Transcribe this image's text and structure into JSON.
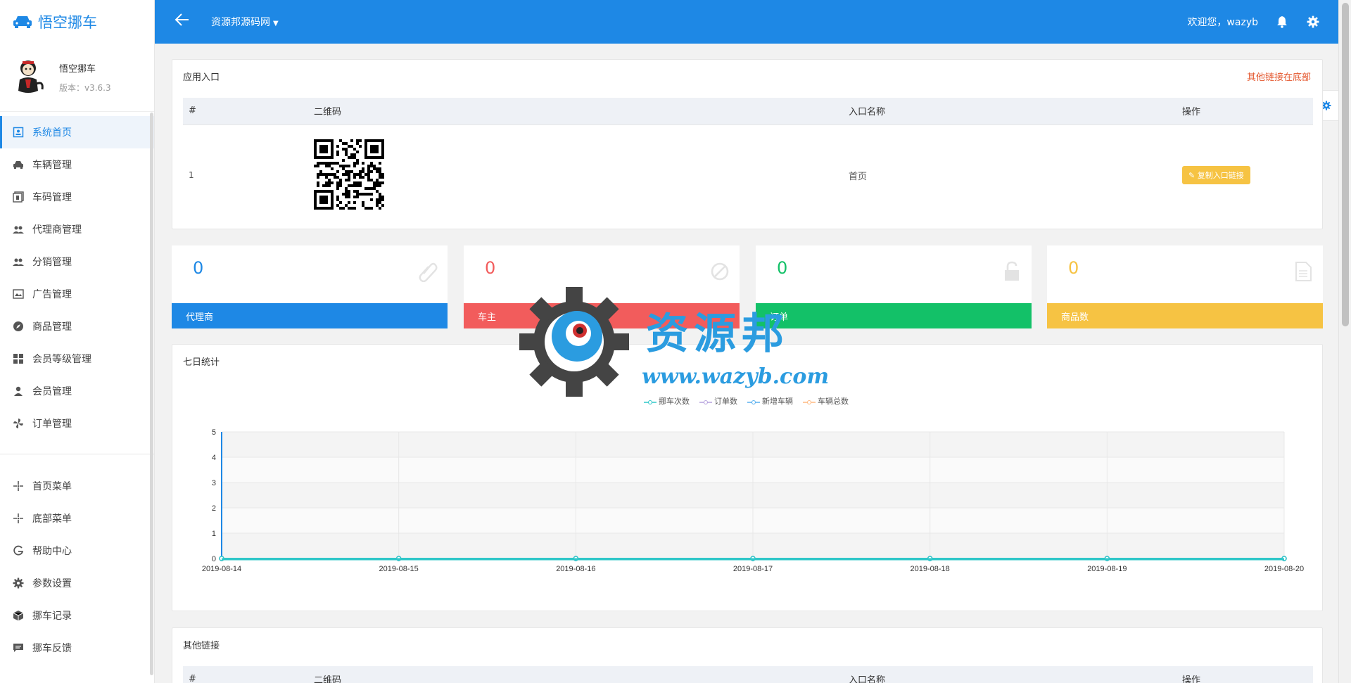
{
  "app": {
    "name": "悟空挪车",
    "version_label": "版本：v3.6.3"
  },
  "header": {
    "site": "资源邦源码网",
    "welcome": "欢迎您，wazyb"
  },
  "sidebar": {
    "items": [
      {
        "label": "系统首页",
        "icon": "home-icon"
      },
      {
        "label": "车辆管理",
        "icon": "car-icon"
      },
      {
        "label": "车码管理",
        "icon": "qrcode-icon"
      },
      {
        "label": "代理商管理",
        "icon": "agents-icon"
      },
      {
        "label": "分销管理",
        "icon": "distribution-icon"
      },
      {
        "label": "广告管理",
        "icon": "ad-icon"
      },
      {
        "label": "商品管理",
        "icon": "compass-icon"
      },
      {
        "label": "会员等级管理",
        "icon": "grid-icon"
      },
      {
        "label": "会员管理",
        "icon": "user-icon"
      },
      {
        "label": "订单管理",
        "icon": "pinwheel-icon"
      }
    ],
    "items2": [
      {
        "label": "首页菜单",
        "icon": "sparkle-icon"
      },
      {
        "label": "底部菜单",
        "icon": "sparkle-icon"
      },
      {
        "label": "帮助中心",
        "icon": "g-icon"
      },
      {
        "label": "参数设置",
        "icon": "gear-icon"
      },
      {
        "label": "挪车记录",
        "icon": "box-icon"
      },
      {
        "label": "挪车反馈",
        "icon": "chat-icon"
      }
    ]
  },
  "entry": {
    "title": "应用入口",
    "link": "其他链接在底部",
    "cols": [
      "#",
      "二维码",
      "入口名称",
      "操作"
    ],
    "row": {
      "index": "1",
      "name": "首页",
      "action": "复制入口链接"
    }
  },
  "stats": [
    {
      "value": "0",
      "label": "代理商",
      "color": "#1e88e5",
      "icon": "paperclip-icon"
    },
    {
      "value": "0",
      "label": "车主",
      "color": "#f25c5c",
      "icon": "ban-icon"
    },
    {
      "value": "0",
      "label": "订单",
      "color": "#13c168",
      "icon": "unlock-icon"
    },
    {
      "value": "0",
      "label": "商品数",
      "color": "#f6c343",
      "icon": "file-icon"
    }
  ],
  "weekly": {
    "title": "七日统计"
  },
  "other": {
    "title": "其他链接",
    "cols": [
      "#",
      "二维码",
      "入口名称",
      "操作"
    ]
  },
  "watermark": {
    "cn": "资源邦",
    "url": "www.wazyb.com"
  },
  "chart_data": {
    "type": "line",
    "categories": [
      "2019-08-14",
      "2019-08-15",
      "2019-08-16",
      "2019-08-17",
      "2019-08-18",
      "2019-08-19",
      "2019-08-20"
    ],
    "series": [
      {
        "name": "挪车次数",
        "values": [
          0,
          0,
          0,
          0,
          0,
          0,
          0
        ],
        "color": "#2ec7c9"
      },
      {
        "name": "订单数",
        "values": [
          0,
          0,
          0,
          0,
          0,
          0,
          0
        ],
        "color": "#b6a2de"
      },
      {
        "name": "新增车辆",
        "values": [
          0,
          0,
          0,
          0,
          0,
          0,
          0
        ],
        "color": "#5ab1ef"
      },
      {
        "name": "车辆总数",
        "values": [
          0,
          0,
          0,
          0,
          0,
          0,
          0
        ],
        "color": "#ffb980"
      }
    ],
    "ylim": [
      0,
      5
    ],
    "yticks": [
      "0",
      "1",
      "2",
      "3",
      "4",
      "5"
    ]
  }
}
